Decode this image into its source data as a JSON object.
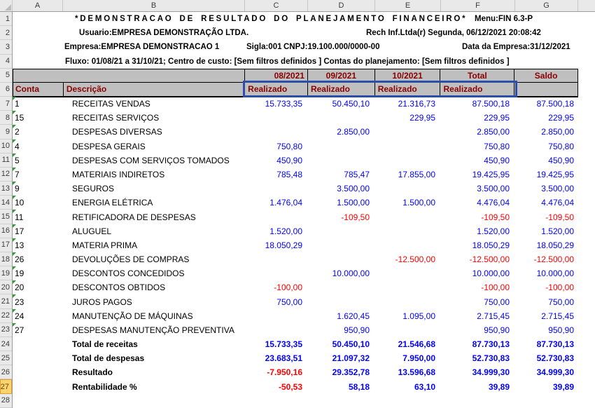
{
  "column_headers": [
    "A",
    "B",
    "C",
    "D",
    "E",
    "F",
    "G"
  ],
  "row_count": 28,
  "active_row": 27,
  "colors": {
    "header_fill": "#BFBFBF",
    "header_text": "#8B0000",
    "value_positive": "#0000FF",
    "value_negative": "#FF0000",
    "selection_border": "#2B4EA8",
    "active_row_fill": "#FBD56B",
    "flag_green": "#2E9B33"
  },
  "title": {
    "line1_main": "*DEMONSTRACAO DE RESULTADO DO PLANEJAMENTO FINANCEIRO*",
    "line1_menu": "Menu:FIN 6.3-P",
    "line2_user": "Usuario:EMPRESA DEMONSTRAÇÃO LTDA.",
    "line2_right": "Rech Inf.Ltda(r)  Segunda, 06/12/2021 20:08:42",
    "line3_empresa": "Empresa:EMPRESA DEMONSTRACAO 1",
    "line3_sigla": "Sigla:001",
    "line3_cnpj": "CNPJ:19.100.000/0000-00",
    "line3_data": "Data da Empresa:31/12/2021",
    "line4_fluxo": "Fluxo: 01/08/21 a 31/10/21; Centro de custo: [Sem filtros definidos ] Contas do planejamento: [Sem filtros definidos ]"
  },
  "table": {
    "period_headers": [
      "08/2021",
      "09/2021",
      "10/2021",
      "Total",
      "Saldo"
    ],
    "col_conta": "Conta",
    "col_descricao": "Descrição",
    "realizado_label": "Realizado",
    "rows": [
      {
        "conta": "1",
        "descricao": "RECEITAS VENDAS",
        "values": [
          "15.733,35",
          "50.450,10",
          "21.316,73",
          "87.500,18",
          "87.500,18"
        ]
      },
      {
        "conta": "15",
        "descricao": "RECEITAS SERVIÇOS",
        "values": [
          "",
          "",
          "229,95",
          "229,95",
          "229,95"
        ]
      },
      {
        "conta": "2",
        "descricao": "DESPESAS DIVERSAS",
        "values": [
          "",
          "2.850,00",
          "",
          "2.850,00",
          "2.850,00"
        ]
      },
      {
        "conta": "4",
        "descricao": "DESPESA GERAIS",
        "values": [
          "750,80",
          "",
          "",
          "750,80",
          "750,80"
        ]
      },
      {
        "conta": "5",
        "descricao": "DESPESAS COM SERVIÇOS TOMADOS",
        "values": [
          "450,90",
          "",
          "",
          "450,90",
          "450,90"
        ]
      },
      {
        "conta": "7",
        "descricao": "MATERIAIS INDIRETOS",
        "values": [
          "785,48",
          "785,47",
          "17.855,00",
          "19.425,95",
          "19.425,95"
        ]
      },
      {
        "conta": "9",
        "descricao": "SEGUROS",
        "values": [
          "",
          "3.500,00",
          "",
          "3.500,00",
          "3.500,00"
        ]
      },
      {
        "conta": "10",
        "descricao": "ENERGIA ELÉTRICA",
        "values": [
          "1.476,04",
          "1.500,00",
          "1.500,00",
          "4.476,04",
          "4.476,04"
        ]
      },
      {
        "conta": "11",
        "descricao": "RETIFICADORA DE DESPESAS",
        "values": [
          "",
          "-109,50",
          "",
          "-109,50",
          "-109,50"
        ]
      },
      {
        "conta": "17",
        "descricao": "ALUGUEL",
        "values": [
          "1.520,00",
          "",
          "",
          "1.520,00",
          "1.520,00"
        ]
      },
      {
        "conta": "13",
        "descricao": "MATERIA PRIMA",
        "values": [
          "18.050,29",
          "",
          "",
          "18.050,29",
          "18.050,29"
        ]
      },
      {
        "conta": "26",
        "descricao": "DEVOLUÇÕES DE COMPRAS",
        "values": [
          "",
          "",
          "-12.500,00",
          "-12.500,00",
          "-12.500,00"
        ]
      },
      {
        "conta": "19",
        "descricao": "DESCONTOS CONCEDIDOS",
        "values": [
          "",
          "10.000,00",
          "",
          "10.000,00",
          "10.000,00"
        ]
      },
      {
        "conta": "20",
        "descricao": "DESCONTOS OBTIDOS",
        "values": [
          "-100,00",
          "",
          "",
          "-100,00",
          "-100,00"
        ]
      },
      {
        "conta": "23",
        "descricao": "JUROS PAGOS",
        "values": [
          "750,00",
          "",
          "",
          "750,00",
          "750,00"
        ]
      },
      {
        "conta": "24",
        "descricao": "MANUTENÇÃO DE MÁQUINAS",
        "values": [
          "",
          "1.620,45",
          "1.095,00",
          "2.715,45",
          "2.715,45"
        ]
      },
      {
        "conta": "27",
        "descricao": "DESPESAS MANUTENÇÃO PREVENTIVA",
        "values": [
          "",
          "950,90",
          "",
          "950,90",
          "950,90"
        ]
      }
    ],
    "totals": [
      {
        "label": "Total de receitas",
        "values": [
          "15.733,35",
          "50.450,10",
          "21.546,68",
          "87.730,13",
          "87.730,13"
        ]
      },
      {
        "label": "Total de despesas",
        "values": [
          "23.683,51",
          "21.097,32",
          "7.950,00",
          "52.730,83",
          "52.730,83"
        ]
      },
      {
        "label": "Resultado",
        "values": [
          "-7.950,16",
          "29.352,78",
          "13.596,68",
          "34.999,30",
          "34.999,30"
        ]
      },
      {
        "label": "Rentabilidade %",
        "values": [
          "-50,53",
          "58,18",
          "63,10",
          "39,89",
          "39,89"
        ]
      }
    ]
  }
}
